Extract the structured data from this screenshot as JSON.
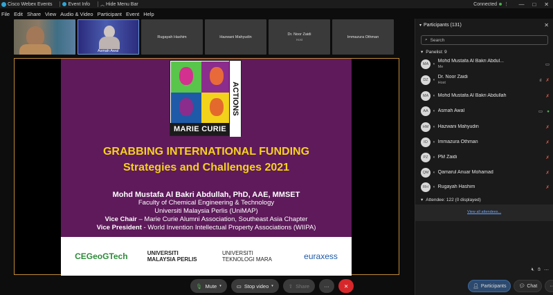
{
  "titlebar": {
    "app_name": "Cisco Webex Events",
    "event_info": "Event Info",
    "hide_menu": "Hide Menu Bar",
    "connection": "Connected",
    "minimize": "—",
    "maximize": "□",
    "close": "✕"
  },
  "menu": [
    "File",
    "Edit",
    "Share",
    "View",
    "Audio & Video",
    "Participant",
    "Event",
    "Help"
  ],
  "thumbnails": [
    {
      "name": "",
      "type": "video"
    },
    {
      "name": "Asmah Awal",
      "type": "video2"
    },
    {
      "name": "Rugayah Hashim",
      "sub": ""
    },
    {
      "name": "Hazwani Mahyudin",
      "sub": ""
    },
    {
      "name": "Dr. Noor Zaidi",
      "sub": "Host"
    },
    {
      "name": "Immazura Othman",
      "sub": ""
    }
  ],
  "slide": {
    "logo_text": "MARIE CURIE",
    "logo_vertical": "ACTIONS",
    "title_line1": "GRABBING INTERNATIONAL FUNDING",
    "title_line2": "Strategies and Challenges 2021",
    "presenter": "Mohd Mustafa Al Bakri Abdullah, PhD, AAE, MMSET",
    "faculty": "Faculty of Chemical Engineering & Technology",
    "university": "Universiti Malaysia Perlis (UniMAP)",
    "vice_chair_label": "Vice Chair",
    "vice_chair_text": " – Marie Curie Alumni Association, Southeast Asia Chapter",
    "vice_pres_label": "Vice President",
    "vice_pres_text": " - World Invention Intellectual Property Associations (WIIPA)",
    "logos": [
      "CEGeoGTech",
      "UNIVERSITI MALAYSIA PERLIS",
      "UNIVERSITI TEKNOLOGI MARA",
      "euraxess"
    ],
    "colors": {
      "background": "#5e1a5b",
      "title": "#f6d21c"
    }
  },
  "controls": {
    "mute": "Mute",
    "stop_video": "Stop video",
    "share": "Share",
    "more": "···",
    "leave": "✕"
  },
  "panel": {
    "title": "Participants (131)",
    "search_placeholder": "Search",
    "panelist_header": "Panelist: 9",
    "participants": [
      {
        "initials": "MA",
        "name": "Mohd Mustafa Al Bakri Abdul...",
        "sub": "Me",
        "video": true,
        "mic": "muted"
      },
      {
        "initials": "DZ",
        "name": "Dr. Noor Zaidi",
        "sub": "Host",
        "video": false,
        "mic": "muted"
      },
      {
        "initials": "MA",
        "name": "Mohd Mustafa Al Bakri Abdullah",
        "sub": "",
        "video": false,
        "mic": "muted"
      },
      {
        "initials": "AA",
        "name": "Asmah Awal",
        "sub": "",
        "video": true,
        "mic": "on"
      },
      {
        "initials": "HM",
        "name": "Hazwani Mahyudin",
        "sub": "",
        "video": false,
        "mic": "muted"
      },
      {
        "initials": "IO",
        "name": "Immazura Othman",
        "sub": "",
        "video": false,
        "mic": "muted"
      },
      {
        "initials": "PZ",
        "name": "PM Zaidi",
        "sub": "",
        "video": false,
        "mic": "muted"
      },
      {
        "initials": "QM",
        "name": "Qamarul Anuar Mohamad",
        "sub": "",
        "video": false,
        "mic": "muted"
      },
      {
        "initials": "RH",
        "name": "Rugayah Hashim",
        "sub": "",
        "video": false,
        "mic": "muted"
      }
    ],
    "attendee_header": "Attendee: 122 (0 displayed)",
    "view_all": "View all attendees...",
    "btn_participants": "Participants",
    "btn_chat": "Chat",
    "btn_more": "···"
  }
}
